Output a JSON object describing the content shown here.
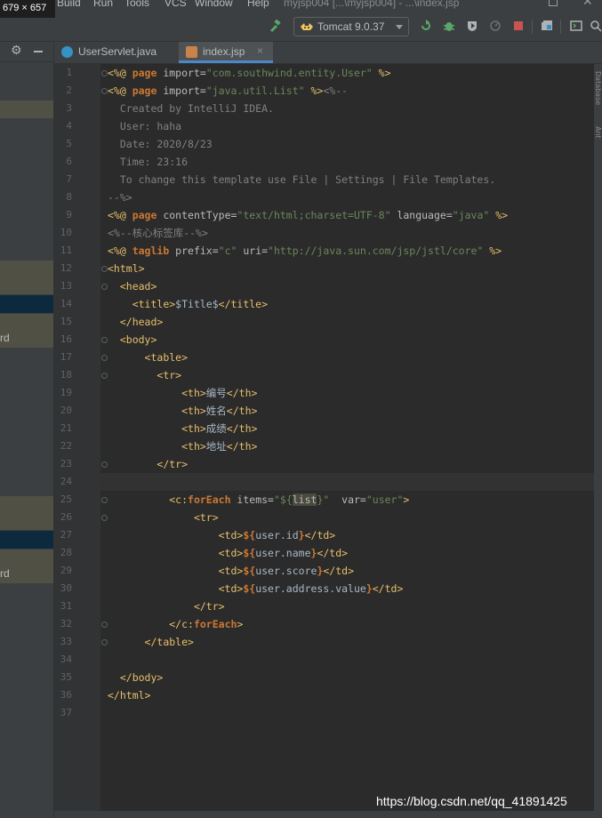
{
  "overlay_size_label": "679 × 657",
  "menu": [
    "Build",
    "Run",
    "Tools",
    "VCS",
    "Window",
    "Help"
  ],
  "window_title": "myjsp004 [...\\myjsp004] - ...\\index.jsp",
  "toolbar": {
    "run_config": "Tomcat 9.0.37"
  },
  "left_panel": {
    "row_texts": [
      "rd",
      "rd"
    ]
  },
  "tabs": [
    {
      "label": "UserServlet.java",
      "active": false
    },
    {
      "label": "index.jsp",
      "active": true
    }
  ],
  "right_strip_labels": [
    "Database",
    "Ant"
  ],
  "editor": {
    "current_line": 24,
    "lines": [
      {
        "n": "1",
        "t": [
          [
            "tag",
            "<%@ "
          ],
          [
            "kw",
            "page "
          ],
          [
            "attr",
            "import="
          ],
          [
            "str",
            "\"com.southwind.entity.User\""
          ],
          [
            "tag",
            " %>"
          ]
        ]
      },
      {
        "n": "2",
        "t": [
          [
            "tag",
            "<%@ "
          ],
          [
            "kw",
            "page "
          ],
          [
            "attr",
            "import="
          ],
          [
            "str",
            "\"java.util.List\""
          ],
          [
            "tag",
            " %>"
          ],
          [
            "cm",
            "<%--"
          ]
        ]
      },
      {
        "n": "3",
        "t": [
          [
            "cm",
            "  Created by IntelliJ IDEA."
          ]
        ]
      },
      {
        "n": "4",
        "t": [
          [
            "cm",
            "  User: haha"
          ]
        ]
      },
      {
        "n": "5",
        "t": [
          [
            "cm",
            "  Date: 2020/8/23"
          ]
        ]
      },
      {
        "n": "6",
        "t": [
          [
            "cm",
            "  Time: 23:16"
          ]
        ]
      },
      {
        "n": "7",
        "t": [
          [
            "cm",
            "  To change this template use File | Settings | File Templates."
          ]
        ]
      },
      {
        "n": "8",
        "t": [
          [
            "cm",
            "--%>"
          ]
        ]
      },
      {
        "n": "9",
        "t": [
          [
            "tag",
            "<%@ "
          ],
          [
            "kw",
            "page "
          ],
          [
            "attr",
            "contentType="
          ],
          [
            "str",
            "\"text/html;charset=UTF-8\""
          ],
          [
            "attr",
            " language="
          ],
          [
            "str",
            "\"java\""
          ],
          [
            "tag",
            " %>"
          ]
        ]
      },
      {
        "n": "10",
        "t": [
          [
            "cm",
            "<%--核心标签库--%>"
          ]
        ]
      },
      {
        "n": "11",
        "t": [
          [
            "tag",
            "<%@ "
          ],
          [
            "kw",
            "taglib "
          ],
          [
            "attr",
            "prefix="
          ],
          [
            "str",
            "\"c\""
          ],
          [
            "attr",
            " uri="
          ],
          [
            "str",
            "\"http://java.sun.com/jsp/jstl/core\""
          ],
          [
            "tag",
            " %>"
          ]
        ]
      },
      {
        "n": "12",
        "t": [
          [
            "tag",
            "<html>"
          ]
        ]
      },
      {
        "n": "13",
        "t": [
          [
            "plain",
            "  "
          ],
          [
            "tag",
            "<head>"
          ]
        ]
      },
      {
        "n": "14",
        "t": [
          [
            "plain",
            "    "
          ],
          [
            "tag",
            "<title>"
          ],
          [
            "plain",
            "$Title$"
          ],
          [
            "tag",
            "</title>"
          ]
        ]
      },
      {
        "n": "15",
        "t": [
          [
            "plain",
            "  "
          ],
          [
            "tag",
            "</head>"
          ]
        ]
      },
      {
        "n": "16",
        "t": [
          [
            "plain",
            "  "
          ],
          [
            "tag",
            "<body>"
          ]
        ]
      },
      {
        "n": "17",
        "t": [
          [
            "plain",
            "      "
          ],
          [
            "tag",
            "<table>"
          ]
        ]
      },
      {
        "n": "18",
        "t": [
          [
            "plain",
            "        "
          ],
          [
            "tag",
            "<tr>"
          ]
        ]
      },
      {
        "n": "19",
        "t": [
          [
            "plain",
            "            "
          ],
          [
            "tag",
            "<th>"
          ],
          [
            "plain",
            "编号"
          ],
          [
            "tag",
            "</th>"
          ]
        ]
      },
      {
        "n": "20",
        "t": [
          [
            "plain",
            "            "
          ],
          [
            "tag",
            "<th>"
          ],
          [
            "plain",
            "姓名"
          ],
          [
            "tag",
            "</th>"
          ]
        ]
      },
      {
        "n": "21",
        "t": [
          [
            "plain",
            "            "
          ],
          [
            "tag",
            "<th>"
          ],
          [
            "plain",
            "成绩"
          ],
          [
            "tag",
            "</th>"
          ]
        ]
      },
      {
        "n": "22",
        "t": [
          [
            "plain",
            "            "
          ],
          [
            "tag",
            "<th>"
          ],
          [
            "plain",
            "地址"
          ],
          [
            "tag",
            "</th>"
          ]
        ]
      },
      {
        "n": "23",
        "t": [
          [
            "plain",
            "        "
          ],
          [
            "tag",
            "</tr>"
          ]
        ]
      },
      {
        "n": "24",
        "t": []
      },
      {
        "n": "25",
        "t": [
          [
            "plain",
            "          "
          ],
          [
            "tag",
            "<c:"
          ],
          [
            "kw",
            "forEach "
          ],
          [
            "attr",
            "items="
          ],
          [
            "str",
            "\"${"
          ],
          [
            "hl",
            "list"
          ],
          [
            "str",
            "}\""
          ],
          [
            "attr",
            "  var="
          ],
          [
            "str",
            "\"user\""
          ],
          [
            "tag",
            ">"
          ]
        ]
      },
      {
        "n": "26",
        "t": [
          [
            "plain",
            "              "
          ],
          [
            "tag",
            "<tr>"
          ]
        ]
      },
      {
        "n": "27",
        "t": [
          [
            "plain",
            "                  "
          ],
          [
            "tag",
            "<td>"
          ],
          [
            "kw",
            "${"
          ],
          [
            "plain",
            "user.id"
          ],
          [
            "kw",
            "}"
          ],
          [
            "tag",
            "</td>"
          ]
        ]
      },
      {
        "n": "28",
        "t": [
          [
            "plain",
            "                  "
          ],
          [
            "tag",
            "<td>"
          ],
          [
            "kw",
            "${"
          ],
          [
            "plain",
            "user.name"
          ],
          [
            "kw",
            "}"
          ],
          [
            "tag",
            "</td>"
          ]
        ]
      },
      {
        "n": "29",
        "t": [
          [
            "plain",
            "                  "
          ],
          [
            "tag",
            "<td>"
          ],
          [
            "kw",
            "${"
          ],
          [
            "plain",
            "user.score"
          ],
          [
            "kw",
            "}"
          ],
          [
            "tag",
            "</td>"
          ]
        ]
      },
      {
        "n": "30",
        "t": [
          [
            "plain",
            "                  "
          ],
          [
            "tag",
            "<td>"
          ],
          [
            "kw",
            "${"
          ],
          [
            "plain",
            "user.address.value"
          ],
          [
            "kw",
            "}"
          ],
          [
            "tag",
            "</td>"
          ]
        ]
      },
      {
        "n": "31",
        "t": [
          [
            "plain",
            "              "
          ],
          [
            "tag",
            "</tr>"
          ]
        ]
      },
      {
        "n": "32",
        "t": [
          [
            "plain",
            "          "
          ],
          [
            "tag",
            "</c:"
          ],
          [
            "kw",
            "forEach"
          ],
          [
            "tag",
            ">"
          ]
        ]
      },
      {
        "n": "33",
        "t": [
          [
            "plain",
            "      "
          ],
          [
            "tag",
            "</table>"
          ]
        ]
      },
      {
        "n": "34",
        "t": []
      },
      {
        "n": "35",
        "t": [
          [
            "plain",
            "  "
          ],
          [
            "tag",
            "</body>"
          ]
        ]
      },
      {
        "n": "36",
        "t": [
          [
            "tag",
            "</html>"
          ]
        ]
      },
      {
        "n": "37",
        "t": []
      }
    ]
  },
  "watermark": "https://blog.csdn.net/qq_41891425",
  "colors": {
    "accent": "#4a88c7",
    "tag": "#e8bf6a",
    "string": "#6a8759",
    "keyword": "#cc7832",
    "comment": "#808080"
  }
}
